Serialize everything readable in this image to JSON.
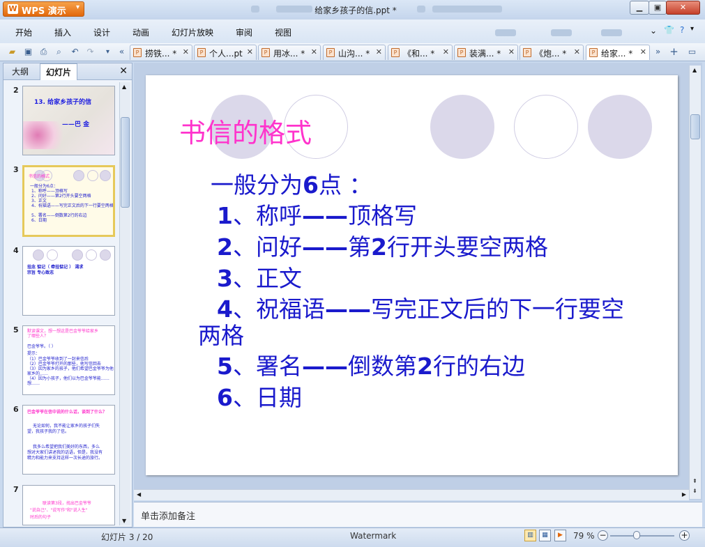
{
  "app": {
    "name": "WPS 演示",
    "logo_letter": "W"
  },
  "window": {
    "title": "给家乡孩子的信.ppt *"
  },
  "menu": {
    "items": [
      "开始",
      "插入",
      "设计",
      "动画",
      "幻灯片放映",
      "审阅",
      "视图"
    ]
  },
  "tabs": [
    {
      "label": "捞铁...",
      "dirty": "*",
      "close": "✕"
    },
    {
      "label": "个人...pt",
      "dirty": "",
      "close": "✕"
    },
    {
      "label": "用冰...",
      "dirty": "*",
      "close": "✕"
    },
    {
      "label": "山沟...",
      "dirty": "*",
      "close": "✕"
    },
    {
      "label": "《和...",
      "dirty": "*",
      "close": "✕"
    },
    {
      "label": "装满...",
      "dirty": "*",
      "close": "✕"
    },
    {
      "label": "《炮...",
      "dirty": "*",
      "close": "✕"
    },
    {
      "label": "给家...",
      "dirty": "*",
      "close": "✕"
    }
  ],
  "panel": {
    "tab_outline": "大纲",
    "tab_slides": "幻灯片",
    "close": "✕"
  },
  "thumbs": {
    "t2": {
      "num": "2",
      "title": "13. 给家乡孩子的信",
      "author": "——巴 金"
    },
    "t3": {
      "num": "3",
      "lines": [
        "书信的格式",
        "一般分为6点：",
        "1、称呼——顶格写",
        "2、问好——第2行开头要空两格",
        "3、正文",
        "4、祝福语——写完正文后的下一行要空两格",
        "5、署名——倒数第2行的右边",
        "6、日期"
      ]
    },
    "t4": {
      "num": "4",
      "lines": [
        "挂念    惦记（ 牵挂惦记 ）  渴求",
        "宗旨      专心致志"
      ]
    },
    "t5": {
      "num": "5",
      "lines": [
        "默读课文，想一想这是巴金爷爷给家乡",
        "了哪些人？",
        "巴金爷爷。（             ）",
        "提示：",
        "（1）巴金爷爷收到了一封来信后",
        "（2）巴金爷爷打开的那些，他写信回去",
        "（3）因为家乡的孩子，他们希望巴金爷爷为他",
        "家乡的……",
        "（4）因为小孩子，他们以为巴金爷爷能……",
        "想……"
      ]
    },
    "t6": {
      "num": "6",
      "lines": [
        "巴金爷爷在信中说的什么话，谈到了什么？",
        "无论如何，我不能让家乡的孩子们失",
        "望，我孩子我的了信。",
        "我多么希望把我们美好的东西，多么",
        "想对大家们讲述我的话语，但是，我没有",
        "精力和能力来支持这样一次长途的旅行。"
      ]
    },
    "t7": {
      "num": "7",
      "lines": [
        "联读第3段，找出巴金爷爷",
        "\"说自己\"、\"说写作\"和\"说人生\"",
        "时后的句子"
      ]
    }
  },
  "slide": {
    "title": "书信的格式",
    "intro_pre": "一般分为",
    "intro_num": "6",
    "intro_post": "点 ：",
    "items": [
      {
        "num": "1",
        "sep": "、",
        "head": "称呼",
        "dash": "——",
        "tail": "顶格写"
      },
      {
        "num": "2",
        "sep": "、",
        "head": "问好",
        "dash": "——",
        "tail_a": "第",
        "tail_num": "2",
        "tail_b": "行开头要空两格"
      },
      {
        "num": "3",
        "sep": "、",
        "head": "正文"
      },
      {
        "num": "4",
        "sep": "、",
        "head": "祝福语",
        "dash": "——",
        "tail": "写完正文后的下一行要空",
        "wrap": "两格"
      },
      {
        "num": "5",
        "sep": "、",
        "head": "署名",
        "dash": "——",
        "tail_a": "倒数第",
        "tail_num": "2",
        "tail_b": "行的右边"
      },
      {
        "num": "6",
        "sep": "、",
        "head": "日期"
      }
    ]
  },
  "notes": {
    "placeholder": "单击添加备注"
  },
  "status": {
    "slide_info": "幻灯片 3 / 20",
    "theme": "Watermark",
    "zoom": "79 %",
    "zoom_minus": "−",
    "zoom_plus": "+"
  },
  "colors": {
    "title": "#ff33cc",
    "body": "#1a1acc",
    "accent": "#e2680c"
  }
}
